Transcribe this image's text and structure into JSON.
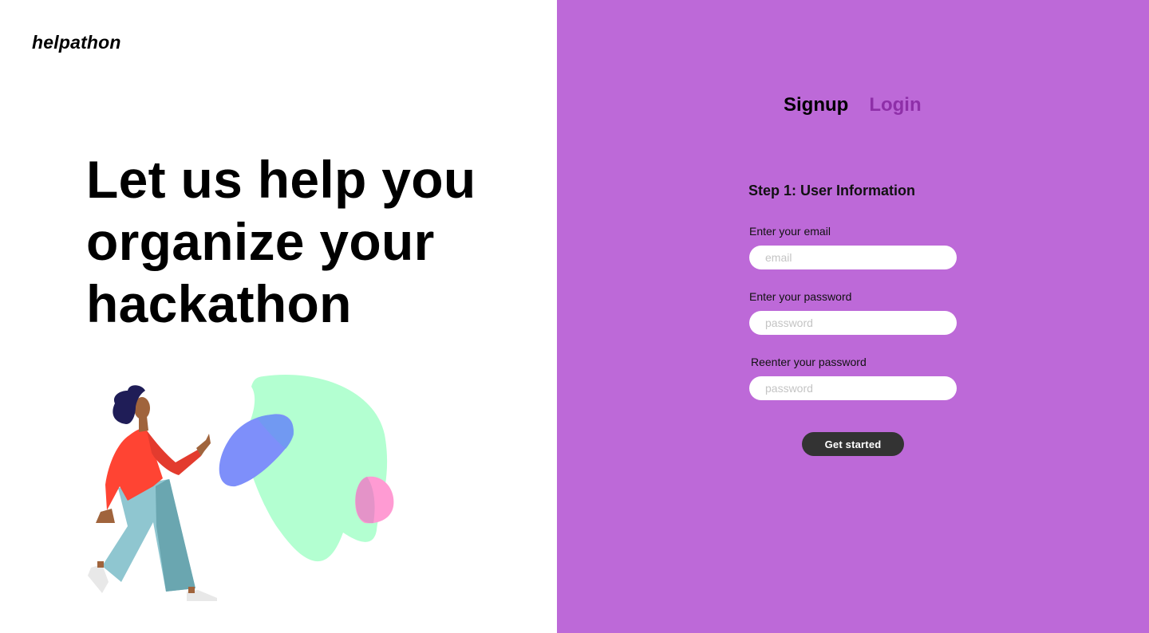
{
  "brand": {
    "logo_text": "helpathon"
  },
  "hero": {
    "headline": "Let us help you organize your hackathon"
  },
  "auth": {
    "tabs": [
      {
        "label": "Signup",
        "active": true
      },
      {
        "label": "Login",
        "active": false
      }
    ]
  },
  "form": {
    "step_title": "Step 1: User Information",
    "fields": [
      {
        "label": "Enter your email",
        "placeholder": "email",
        "value": ""
      },
      {
        "label": "Enter your password",
        "placeholder": "password",
        "value": ""
      },
      {
        "label": "Reenter your password",
        "placeholder": "password",
        "value": ""
      }
    ],
    "submit_label": "Get started"
  },
  "colors": {
    "panel_background": "#bd69d8",
    "inactive_tab": "#8e2fa8",
    "button_background": "#333333",
    "blob_green": "#b3ffd1",
    "blob_blue": "#7e8ffa",
    "blob_pink": "#ff9bd3"
  },
  "illustration": {
    "icon": "person-walking-illustration"
  }
}
